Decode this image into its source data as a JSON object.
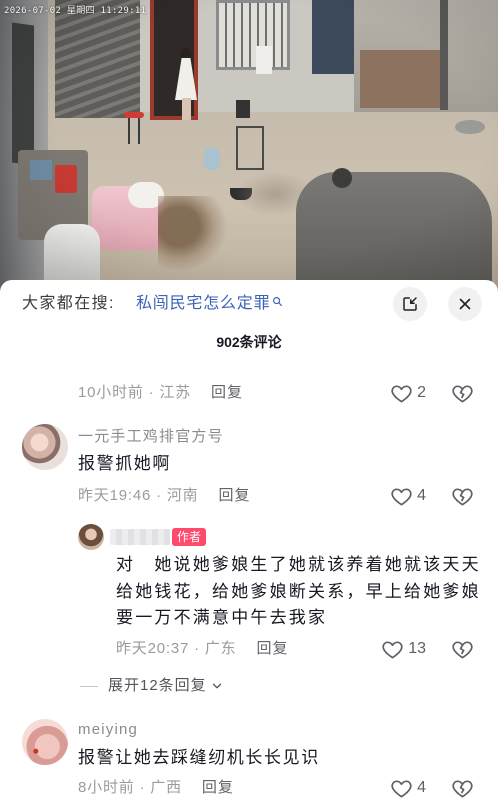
{
  "video": {
    "timestamp": "2026-07-02 星期四 11:29:11"
  },
  "search_bar": {
    "prefix": "大家都在搜:",
    "query": "私闯民宅怎么定罪",
    "query_icon": "search-icon"
  },
  "header_buttons": {
    "minimize_icon": "picture-in-picture-icon",
    "close_icon": "close-icon"
  },
  "comments_title": "902条评论",
  "comments": [
    {
      "time_location": "10小时前 · 江苏",
      "reply_label": "回复",
      "likes": "2"
    },
    {
      "username": "一元手工鸡排官方号",
      "text": "报警抓她啊",
      "time_location": "昨天19:46 · 河南",
      "reply_label": "回复",
      "likes": "4",
      "replies": [
        {
          "badge": "作者",
          "text_lines": [
            "对　她说她爹娘生了她就该养着她就该天天",
            "给她钱花，给她爹娘断关系，早上给她爹娘",
            "要一万不满意中午去我家"
          ],
          "time_location": "昨天20:37 · 广东",
          "reply_label": "回复",
          "likes": "13"
        }
      ],
      "expand_label": "展开12条回复"
    },
    {
      "username": "meiying",
      "text": "报警让她去踩缝纫机长长见识",
      "time_location": "8小时前 · 广西",
      "reply_label": "回复",
      "likes": "4"
    }
  ],
  "icons": {
    "like": "heart-icon",
    "dislike": "broken-heart-icon",
    "expand": "chevron-down-icon"
  },
  "colors": {
    "accent_blue": "#3a63b8",
    "author_badge": "#fe4a6c",
    "text_primary": "#161823",
    "text_secondary": "#8a8b91"
  }
}
